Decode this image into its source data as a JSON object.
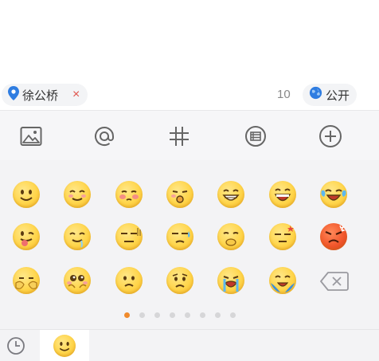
{
  "location": {
    "text": "徐公桥",
    "remove_symbol": "×"
  },
  "char_count": "10",
  "visibility": {
    "label": "公开"
  },
  "toolbar": {
    "items": [
      "image-icon",
      "at-mention-icon",
      "hashtag-icon",
      "long-post-icon",
      "add-icon"
    ]
  },
  "emoji_grid": {
    "rows": [
      [
        "smile",
        "blush",
        "shy",
        "pout",
        "grin",
        "laugh",
        "tears-of-joy"
      ],
      [
        "tongue",
        "drool",
        "bored",
        "sweat",
        "cover-mouth",
        "dizzy",
        "angry"
      ],
      [
        "facepalm",
        "pleading",
        "sad",
        "worried",
        "crying",
        "sobbing",
        "backspace"
      ]
    ]
  },
  "pager": {
    "pages": 8,
    "current": 1
  },
  "bottom_tabs": [
    "recent-clock-icon",
    "emoji-tab-icon"
  ],
  "colors": {
    "accent": "#f08a2c",
    "location_pin": "#2f7de1",
    "remove": "#e0524a",
    "emoji_base": "#ffd54a"
  }
}
